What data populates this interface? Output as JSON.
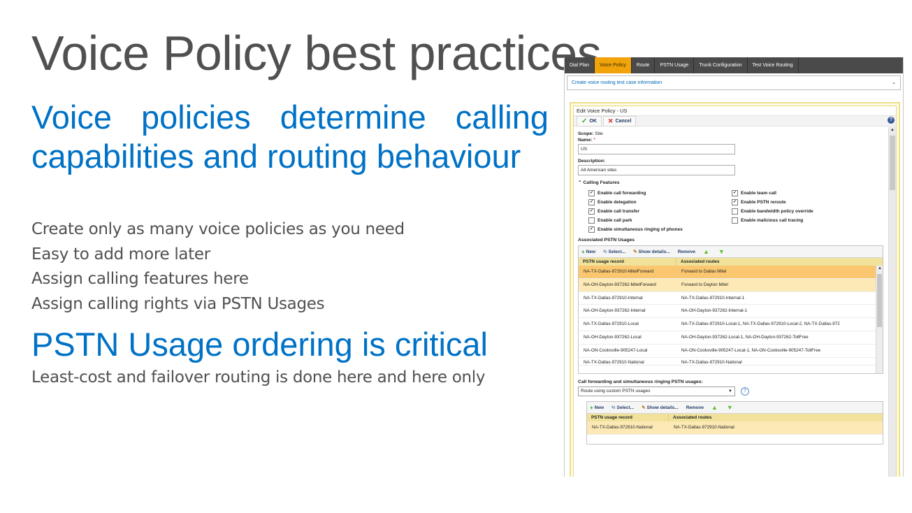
{
  "slide": {
    "title": "Voice Policy best practices",
    "section1_heading": "Voice policies determine calling capabilities and routing behaviour",
    "section1_bullets": [
      "Create only as many voice policies as you need",
      "Easy to add more later",
      "Assign calling features here",
      "Assign calling rights via PSTN Usages"
    ],
    "section2_heading": "PSTN Usage ordering is critical",
    "section2_bullets": [
      "Least-cost and failover routing is done here and here only"
    ]
  },
  "panel": {
    "tabs": [
      "Dial Plan",
      "Voice Policy",
      "Route",
      "PSTN Usage",
      "Trunk Configuration",
      "Test Voice Routing"
    ],
    "active_tab": "Voice Policy",
    "test_selector": "Create voice routing test case information",
    "edit_title": "Edit Voice Policy - US",
    "ok_label": "OK",
    "cancel_label": "Cancel",
    "scope_label": "Scope:",
    "scope_value": "Site",
    "name_label": "Name:",
    "required_marker": "*",
    "name_value": "US",
    "description_label": "Description:",
    "description_value": "All American sites",
    "calling_features_label": "Calling Features",
    "features": [
      {
        "label": "Enable call forwarding",
        "checked": true
      },
      {
        "label": "Enable team call",
        "checked": true
      },
      {
        "label": "Enable delegation",
        "checked": true
      },
      {
        "label": "Enable PSTN reroute",
        "checked": true
      },
      {
        "label": "Enable call transfer",
        "checked": true
      },
      {
        "label": "Enable bandwidth policy override",
        "checked": false
      },
      {
        "label": "Enable call park",
        "checked": false
      },
      {
        "label": "Enable malicious call tracing",
        "checked": false
      },
      {
        "label": "Enable simultaneous ringing of phones",
        "checked": true
      }
    ],
    "associated_usages_label": "Associated PSTN Usages",
    "toolbar": {
      "new": "New",
      "select": "Select...",
      "show_details": "Show details...",
      "remove": "Remove"
    },
    "columns": [
      "PSTN usage record",
      "Associated routes"
    ],
    "usage_rows": [
      [
        "NA-TX-Dallas-972910-MitelForward",
        "Forward to Dallas Mitel"
      ],
      [
        "NA-OH-Dayton-937262-MitelForward",
        "Forward to Dayton Mitel"
      ],
      [
        "NA-TX-Dallas-972910-Internal",
        "NA-TX-Dallas-972910-Internal-1"
      ],
      [
        "NA-OH-Dayton-937262-Internal",
        "NA-OH-Dayton-937262-Internal-1"
      ],
      [
        "NA-TX-Dallas-972910-Local",
        "NA-TX-Dallas-972910-Local-1, NA-TX-Dallas-972910-Local-2, NA-TX-Dallas-972"
      ],
      [
        "NA-OH-Dayton-937262-Local",
        "NA-OH-Dayton-937262-Local-1, NA-OH-Dayton-937262-TollFree"
      ],
      [
        "NA-ON-Cooksville-905247-Local",
        "NA-ON-Cooksville-905247-Local-1, NA-ON-Cooksville-905247-TollFree"
      ],
      [
        "NA-TX-Dallas-972910-National",
        "NA-TX-Dallas-972910-National"
      ]
    ],
    "forwarding_label": "Call forwarding and simultaneous ringing PSTN usages:",
    "forwarding_dropdown": "Route using custom PSTN usages",
    "forwarding_rows": [
      [
        "NA-TX-Dallas-972910-National",
        "NA-TX-Dallas-972910-National"
      ]
    ],
    "colors": {
      "accent": "#f0a30a",
      "heading_blue": "#0072c6",
      "title_gray": "#505050",
      "selected_row": "#fac770"
    }
  }
}
